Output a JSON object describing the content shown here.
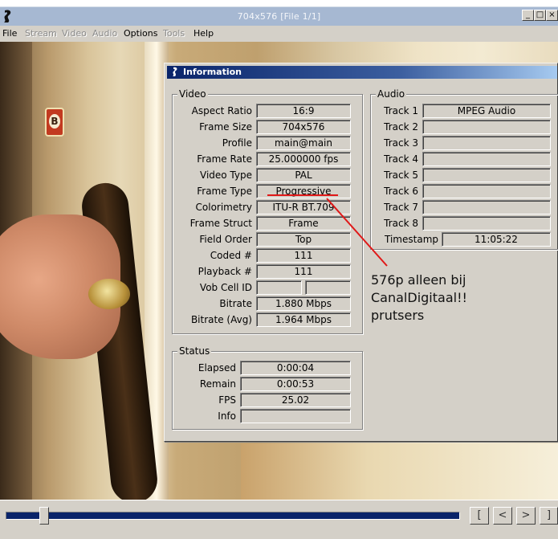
{
  "window": {
    "title": "704x576 [File 1/1]",
    "controls": {
      "minimize": "_",
      "maximize": "□",
      "close": "×"
    }
  },
  "menu": [
    {
      "label": "File",
      "enabled": true
    },
    {
      "label": "Stream",
      "enabled": false
    },
    {
      "label": "Video",
      "enabled": false
    },
    {
      "label": "Audio",
      "enabled": false
    },
    {
      "label": "Options",
      "enabled": true
    },
    {
      "label": "Tools",
      "enabled": false
    },
    {
      "label": "Help",
      "enabled": true
    }
  ],
  "info_dialog": {
    "title": "Information",
    "video": {
      "group_label": "Video",
      "rows": [
        {
          "label": "Aspect Ratio",
          "value": "16:9"
        },
        {
          "label": "Frame Size",
          "value": "704x576"
        },
        {
          "label": "Profile",
          "value": "main@main"
        },
        {
          "label": "Frame Rate",
          "value": "25.000000 fps"
        },
        {
          "label": "Video Type",
          "value": "PAL"
        },
        {
          "label": "Frame Type",
          "value": "Progressive"
        },
        {
          "label": "Colorimetry",
          "value": "ITU-R BT.709"
        },
        {
          "label": "Frame Struct",
          "value": "Frame"
        },
        {
          "label": "Field Order",
          "value": "Top"
        },
        {
          "label": "Coded #",
          "value": "111"
        },
        {
          "label": "Playback #",
          "value": "111"
        },
        {
          "label": "Vob Cell ID",
          "value": "",
          "value2": ""
        },
        {
          "label": "Bitrate",
          "value": "1.880 Mbps"
        },
        {
          "label": "Bitrate (Avg)",
          "value": "1.964 Mbps"
        }
      ]
    },
    "audio": {
      "group_label": "Audio",
      "rows": [
        {
          "label": "Track 1",
          "value": "MPEG Audio"
        },
        {
          "label": "Track 2",
          "value": ""
        },
        {
          "label": "Track 3",
          "value": ""
        },
        {
          "label": "Track 4",
          "value": ""
        },
        {
          "label": "Track 5",
          "value": ""
        },
        {
          "label": "Track 6",
          "value": ""
        },
        {
          "label": "Track 7",
          "value": ""
        },
        {
          "label": "Track 8",
          "value": ""
        },
        {
          "label": "Timestamp",
          "value": "11:05:22"
        }
      ]
    },
    "status": {
      "group_label": "Status",
      "rows": [
        {
          "label": "Elapsed",
          "value": "0:00:04"
        },
        {
          "label": "Remain",
          "value": "0:00:53"
        },
        {
          "label": "FPS",
          "value": "25.02"
        },
        {
          "label": "Info",
          "value": ""
        }
      ]
    }
  },
  "annotation": {
    "lines": [
      "576p alleen bij",
      "CanalDigitaal!!",
      "prutsers"
    ],
    "color": "#e01818"
  },
  "playback": {
    "position_fraction": 0.085,
    "buttons": [
      "[",
      "<",
      ">",
      "]"
    ]
  },
  "colors": {
    "title_active": "#0a246a",
    "face": "#d4d0c8",
    "seek_fill": "#0a246a"
  }
}
